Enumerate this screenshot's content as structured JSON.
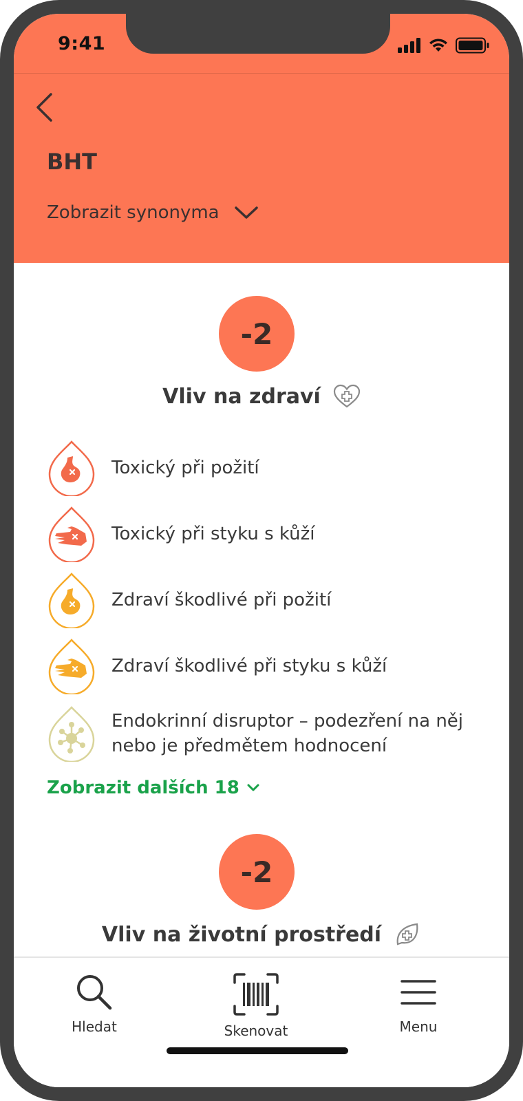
{
  "status_bar": {
    "time": "9:41"
  },
  "header": {
    "title": "BHT",
    "synonyms_label": "Zobrazit synonyma"
  },
  "health": {
    "score": "-2",
    "title": "Vliv na zdraví",
    "hazards": [
      {
        "label": "Toxický při požití",
        "icon": "stomach-icon",
        "severity": "toxic"
      },
      {
        "label": "Toxický při styku s kůží",
        "icon": "hand-icon",
        "severity": "toxic"
      },
      {
        "label": "Zdraví škodlivé při požití",
        "icon": "stomach-icon",
        "severity": "harmful"
      },
      {
        "label": "Zdraví škodlivé při styku s kůží",
        "icon": "hand-icon",
        "severity": "harmful"
      },
      {
        "label": "Endokrinní disruptor – podezření na něj nebo je předmětem hodnocení",
        "icon": "endocrine-icon",
        "severity": "suspected"
      }
    ],
    "more_link": "Zobrazit dalších 18"
  },
  "environment": {
    "score": "-2",
    "title": "Vliv na životní prostředí"
  },
  "bottom_nav": {
    "search_label": "Hledat",
    "scan_label": "Skenovat",
    "menu_label": "Menu"
  },
  "colors": {
    "accent": "#fd7654",
    "toxic": "#f26a4b",
    "harmful": "#f6ab2a",
    "suspected": "#d9d49a",
    "link": "#1aa24a"
  }
}
